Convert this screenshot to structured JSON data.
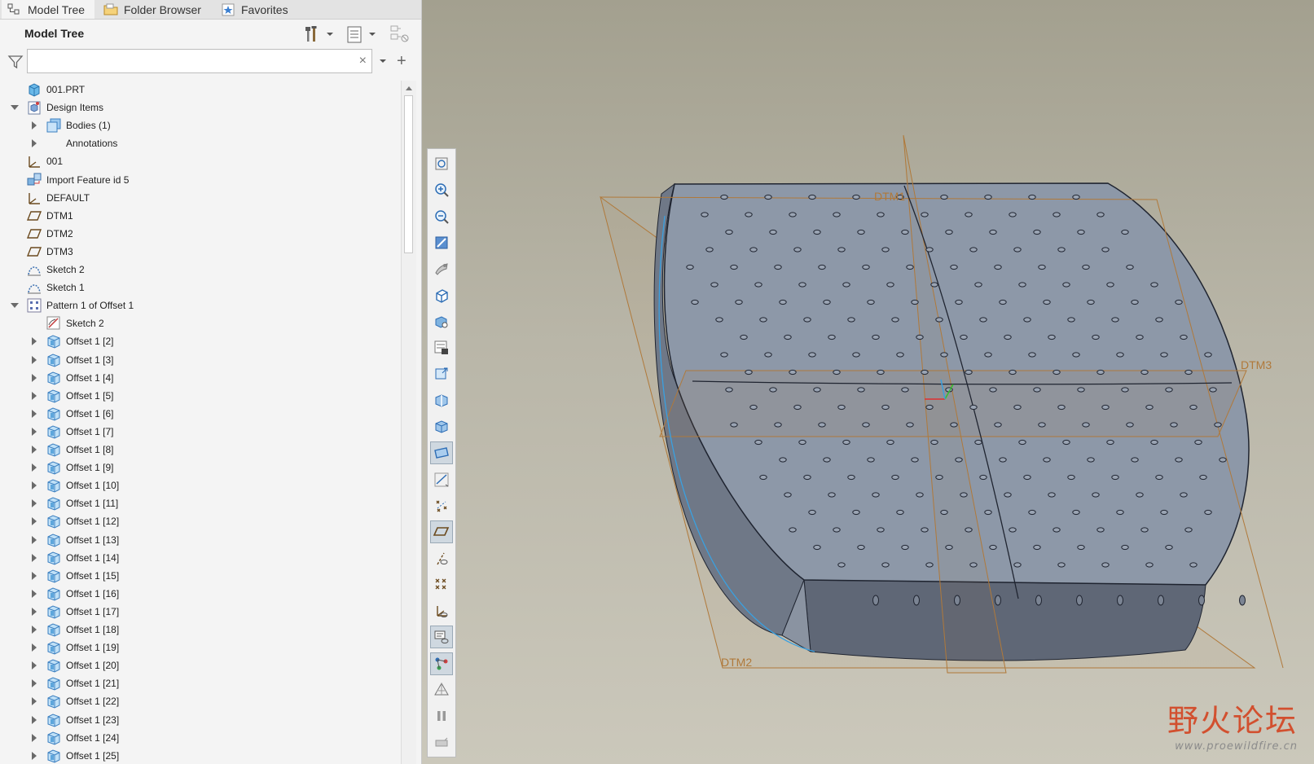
{
  "tabs": [
    {
      "label": "Model Tree",
      "icon": "model-tree-icon",
      "active": true
    },
    {
      "label": "Folder Browser",
      "icon": "folder-icon",
      "active": false
    },
    {
      "label": "Favorites",
      "icon": "favorites-icon",
      "active": false
    }
  ],
  "tree_header": {
    "title": "Model Tree"
  },
  "search": {
    "value": "",
    "placeholder": "",
    "clear": "×"
  },
  "tree": {
    "items": [
      {
        "label": "001.PRT",
        "icon": "part-icon",
        "level": 0,
        "expander": "none"
      },
      {
        "label": "Design Items",
        "icon": "design-items-icon",
        "level": 0,
        "expander": "expanded"
      },
      {
        "label": "Bodies (1)",
        "icon": "bodies-icon",
        "level": 1,
        "expander": "collapsed"
      },
      {
        "label": "Annotations",
        "icon": "",
        "level": 1,
        "expander": "collapsed"
      },
      {
        "label": "001",
        "icon": "coordinate-system-icon",
        "level": 0,
        "expander": "none"
      },
      {
        "label": "Import Feature id 5",
        "icon": "import-feature-icon",
        "level": 0,
        "expander": "none"
      },
      {
        "label": "DEFAULT",
        "icon": "coordinate-system-icon",
        "level": 0,
        "expander": "none"
      },
      {
        "label": "DTM1",
        "icon": "datum-plane-icon",
        "level": 0,
        "expander": "none"
      },
      {
        "label": "DTM2",
        "icon": "datum-plane-icon",
        "level": 0,
        "expander": "none"
      },
      {
        "label": "DTM3",
        "icon": "datum-plane-icon",
        "level": 0,
        "expander": "none"
      },
      {
        "label": "Sketch 2",
        "icon": "sketch-curve-icon",
        "level": 0,
        "expander": "none"
      },
      {
        "label": "Sketch 1",
        "icon": "sketch-curve-icon",
        "level": 0,
        "expander": "none"
      },
      {
        "label": "Pattern 1 of Offset 1",
        "icon": "pattern-icon",
        "level": 0,
        "expander": "expanded"
      },
      {
        "label": "Sketch 2",
        "icon": "sketch-icon",
        "level": 1,
        "expander": "none"
      },
      {
        "label": "Offset 1 [2]",
        "icon": "offset-icon",
        "level": 1,
        "expander": "collapsed"
      },
      {
        "label": "Offset 1 [3]",
        "icon": "offset-icon",
        "level": 1,
        "expander": "collapsed"
      },
      {
        "label": "Offset 1 [4]",
        "icon": "offset-icon",
        "level": 1,
        "expander": "collapsed"
      },
      {
        "label": "Offset 1 [5]",
        "icon": "offset-icon",
        "level": 1,
        "expander": "collapsed"
      },
      {
        "label": "Offset 1 [6]",
        "icon": "offset-icon",
        "level": 1,
        "expander": "collapsed"
      },
      {
        "label": "Offset 1 [7]",
        "icon": "offset-icon",
        "level": 1,
        "expander": "collapsed"
      },
      {
        "label": "Offset 1 [8]",
        "icon": "offset-icon",
        "level": 1,
        "expander": "collapsed"
      },
      {
        "label": "Offset 1 [9]",
        "icon": "offset-icon",
        "level": 1,
        "expander": "collapsed"
      },
      {
        "label": "Offset 1 [10]",
        "icon": "offset-icon",
        "level": 1,
        "expander": "collapsed"
      },
      {
        "label": "Offset 1 [11]",
        "icon": "offset-icon",
        "level": 1,
        "expander": "collapsed"
      },
      {
        "label": "Offset 1 [12]",
        "icon": "offset-icon",
        "level": 1,
        "expander": "collapsed"
      },
      {
        "label": "Offset 1 [13]",
        "icon": "offset-icon",
        "level": 1,
        "expander": "collapsed"
      },
      {
        "label": "Offset 1 [14]",
        "icon": "offset-icon",
        "level": 1,
        "expander": "collapsed"
      },
      {
        "label": "Offset 1 [15]",
        "icon": "offset-icon",
        "level": 1,
        "expander": "collapsed"
      },
      {
        "label": "Offset 1 [16]",
        "icon": "offset-icon",
        "level": 1,
        "expander": "collapsed"
      },
      {
        "label": "Offset 1 [17]",
        "icon": "offset-icon",
        "level": 1,
        "expander": "collapsed"
      },
      {
        "label": "Offset 1 [18]",
        "icon": "offset-icon",
        "level": 1,
        "expander": "collapsed"
      },
      {
        "label": "Offset 1 [19]",
        "icon": "offset-icon",
        "level": 1,
        "expander": "collapsed"
      },
      {
        "label": "Offset 1 [20]",
        "icon": "offset-icon",
        "level": 1,
        "expander": "collapsed"
      },
      {
        "label": "Offset 1 [21]",
        "icon": "offset-icon",
        "level": 1,
        "expander": "collapsed"
      },
      {
        "label": "Offset 1 [22]",
        "icon": "offset-icon",
        "level": 1,
        "expander": "collapsed"
      },
      {
        "label": "Offset 1 [23]",
        "icon": "offset-icon",
        "level": 1,
        "expander": "collapsed"
      },
      {
        "label": "Offset 1 [24]",
        "icon": "offset-icon",
        "level": 1,
        "expander": "collapsed"
      },
      {
        "label": "Offset 1 [25]",
        "icon": "offset-icon",
        "level": 1,
        "expander": "collapsed"
      }
    ]
  },
  "view_toolbar": [
    {
      "icon": "refit-icon",
      "active": false
    },
    {
      "icon": "zoom-in-icon",
      "active": false
    },
    {
      "icon": "zoom-out-icon",
      "active": false
    },
    {
      "icon": "repaint-icon",
      "active": false
    },
    {
      "icon": "render-options-icon",
      "active": false
    },
    {
      "icon": "saved-orientations-icon",
      "active": false
    },
    {
      "icon": "view-manager-icon",
      "active": false
    },
    {
      "icon": "display-style-icon",
      "active": false
    },
    {
      "icon": "appearance-icon",
      "active": false
    },
    {
      "icon": "section-icon",
      "active": false
    },
    {
      "icon": "shading-icon",
      "active": false
    },
    {
      "icon": "shading-edges-icon",
      "active": true
    },
    {
      "icon": "datum-display-filters-icon",
      "active": false
    },
    {
      "icon": "point-display-icon",
      "active": false
    },
    {
      "icon": "plane-display-icon",
      "active": true
    },
    {
      "icon": "axis-display-icon",
      "active": false
    },
    {
      "icon": "point-tag-display-icon",
      "active": false
    },
    {
      "icon": "csys-display-icon",
      "active": false
    },
    {
      "icon": "annotation-display-icon",
      "active": true
    },
    {
      "icon": "spin-center-icon",
      "active": true
    },
    {
      "icon": "perspective-icon",
      "active": false
    },
    {
      "icon": "pause-icon",
      "active": false
    },
    {
      "icon": "more-icon",
      "active": false
    }
  ],
  "datum_labels": {
    "dtm1": "DTM1",
    "dtm2": "DTM2",
    "dtm3": "DTM3"
  },
  "colors": {
    "datum_plane": "#b0793a",
    "model_surface": "#8d98a8",
    "model_edge": "#1f2430",
    "spin_center": "#3aa0e0",
    "watermark": "#d2502f"
  },
  "watermark": {
    "brand": "野火论坛",
    "url": "www.proewildfire.cn"
  }
}
